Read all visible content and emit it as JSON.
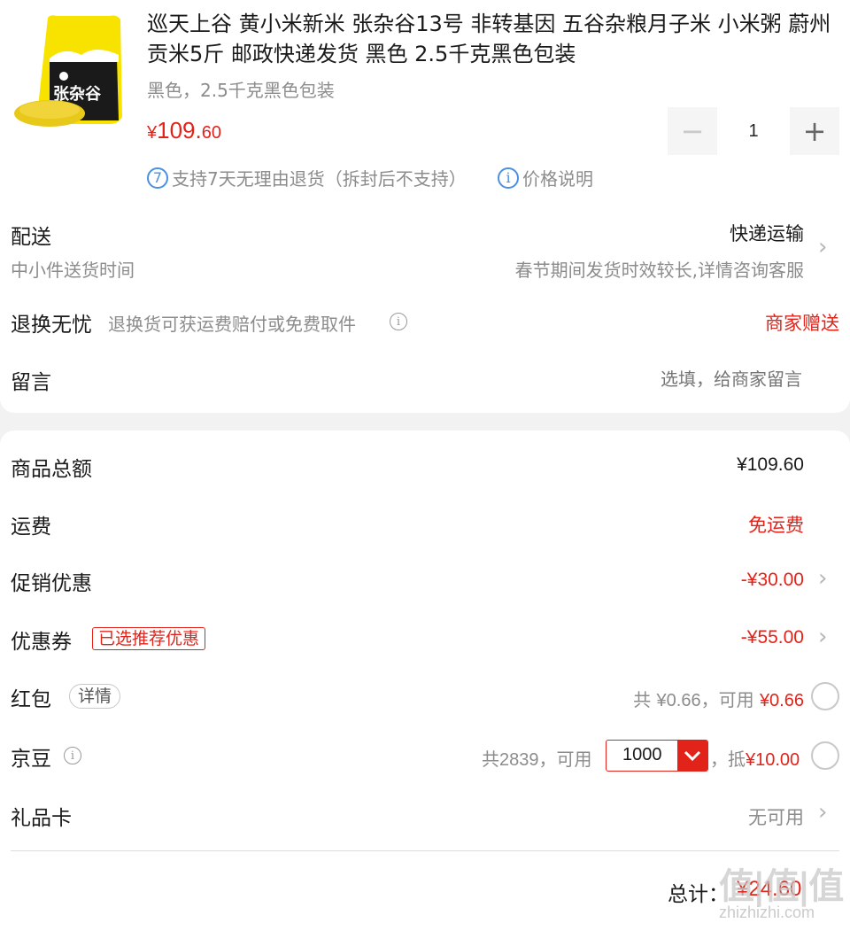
{
  "product": {
    "title": "巡天上谷 黄小米新米 张杂谷13号 非转基因 五谷杂粮月子米 小米粥 蔚州贡米5斤 邮政快递发货 黑色 2.5千克黑色包装",
    "spec": "黑色，2.5千克黑色包装",
    "price_symbol": "¥",
    "price_int": "109.",
    "price_dec": "60",
    "quantity": "1",
    "stepper_minus": "−",
    "stepper_plus": "+",
    "service_return_num": "7",
    "service_return": "支持7天无理由退货（拆封后不支持）",
    "service_price_icon": "i",
    "service_price": "价格说明",
    "image_label": "张杂谷"
  },
  "delivery": {
    "label": "配送",
    "sub": "中小件送货时间",
    "method": "快递运输",
    "note": "春节期间发货时效较长,详情咨询客服"
  },
  "return_service": {
    "label": "退换无忧",
    "desc": "退换货可获运费赔付或免费取件",
    "value": "商家赠送"
  },
  "message": {
    "label": "留言",
    "placeholder": "选填，给商家留言"
  },
  "summary": {
    "goods_total_label": "商品总额",
    "goods_total": "¥109.60",
    "shipping_label": "运费",
    "shipping": "免运费",
    "promo_label": "促销优惠",
    "promo": "-¥30.00",
    "coupon_label": "优惠券",
    "coupon_badge": "已选推荐优惠",
    "coupon": "-¥55.00",
    "redpacket_label": "红包",
    "redpacket_detail": "详情",
    "redpacket_total_prefix": "共 ",
    "redpacket_total": "¥0.66",
    "redpacket_avail_prefix": "，可用 ",
    "redpacket_avail": "¥0.66",
    "beans_label": "京豆",
    "beans_total_prefix": "共",
    "beans_total": "2839",
    "beans_avail_prefix": "，可用",
    "beans_value": "1000",
    "beans_deduct_prefix": "，抵",
    "beans_deduct": "¥10.00",
    "giftcard_label": "礼品卡",
    "giftcard": "无可用",
    "total_label": "总计：",
    "total": "¥24.60"
  },
  "watermark": "值|值|值 zhizhizhi.com",
  "colors": {
    "accent_red": "#e2231a",
    "info_blue": "#4a90e2",
    "muted_gray": "#8c8c8c"
  },
  "icons": [
    "minus-icon",
    "plus-icon",
    "seven-day-return-icon",
    "info-icon",
    "chevron-right-icon",
    "radio-icon",
    "chevron-down-icon"
  ]
}
